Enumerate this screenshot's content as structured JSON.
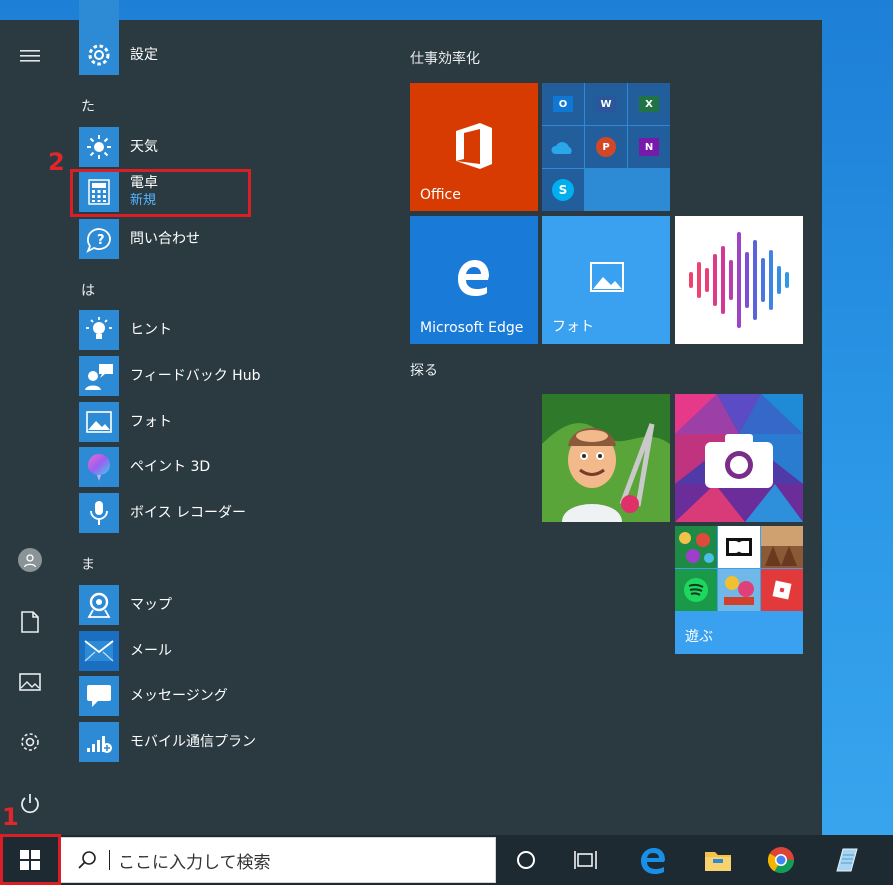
{
  "annotations": {
    "step1": "1",
    "step2": "2"
  },
  "left_rail": {
    "items": [
      "hamburger-icon",
      "user-icon",
      "document-icon",
      "pictures-icon",
      "settings-icon",
      "power-icon"
    ]
  },
  "app_list": {
    "headers": {
      "ta": "た",
      "ha": "は",
      "ma": "ま"
    },
    "apps": {
      "settings": "設定",
      "weather": "天気",
      "calculator": "電卓",
      "calculator_badge": "新規",
      "get_help": "問い合わせ",
      "tips": "ヒント",
      "feedback_hub": "フィードバック Hub",
      "photos": "フォト",
      "paint3d": "ペイント 3D",
      "voice_recorder": "ボイス レコーダー",
      "maps": "マップ",
      "mail": "メール",
      "messaging": "メッセージング",
      "mobile_plans": "モバイル通信プラン"
    }
  },
  "tiles": {
    "group_productivity": "仕事効率化",
    "group_explore": "探る",
    "office": "Office",
    "edge": "Microsoft Edge",
    "photos": "フォト",
    "play": "遊ぶ"
  },
  "colors": {
    "office": "#d83b01",
    "tile_blue": "#2d8ad4",
    "photos_tile": "#3aa0f0",
    "menu_bg": "#2b3a40",
    "callout": "#e1262b"
  },
  "taskbar": {
    "search_placeholder": "ここに入力して検索"
  }
}
